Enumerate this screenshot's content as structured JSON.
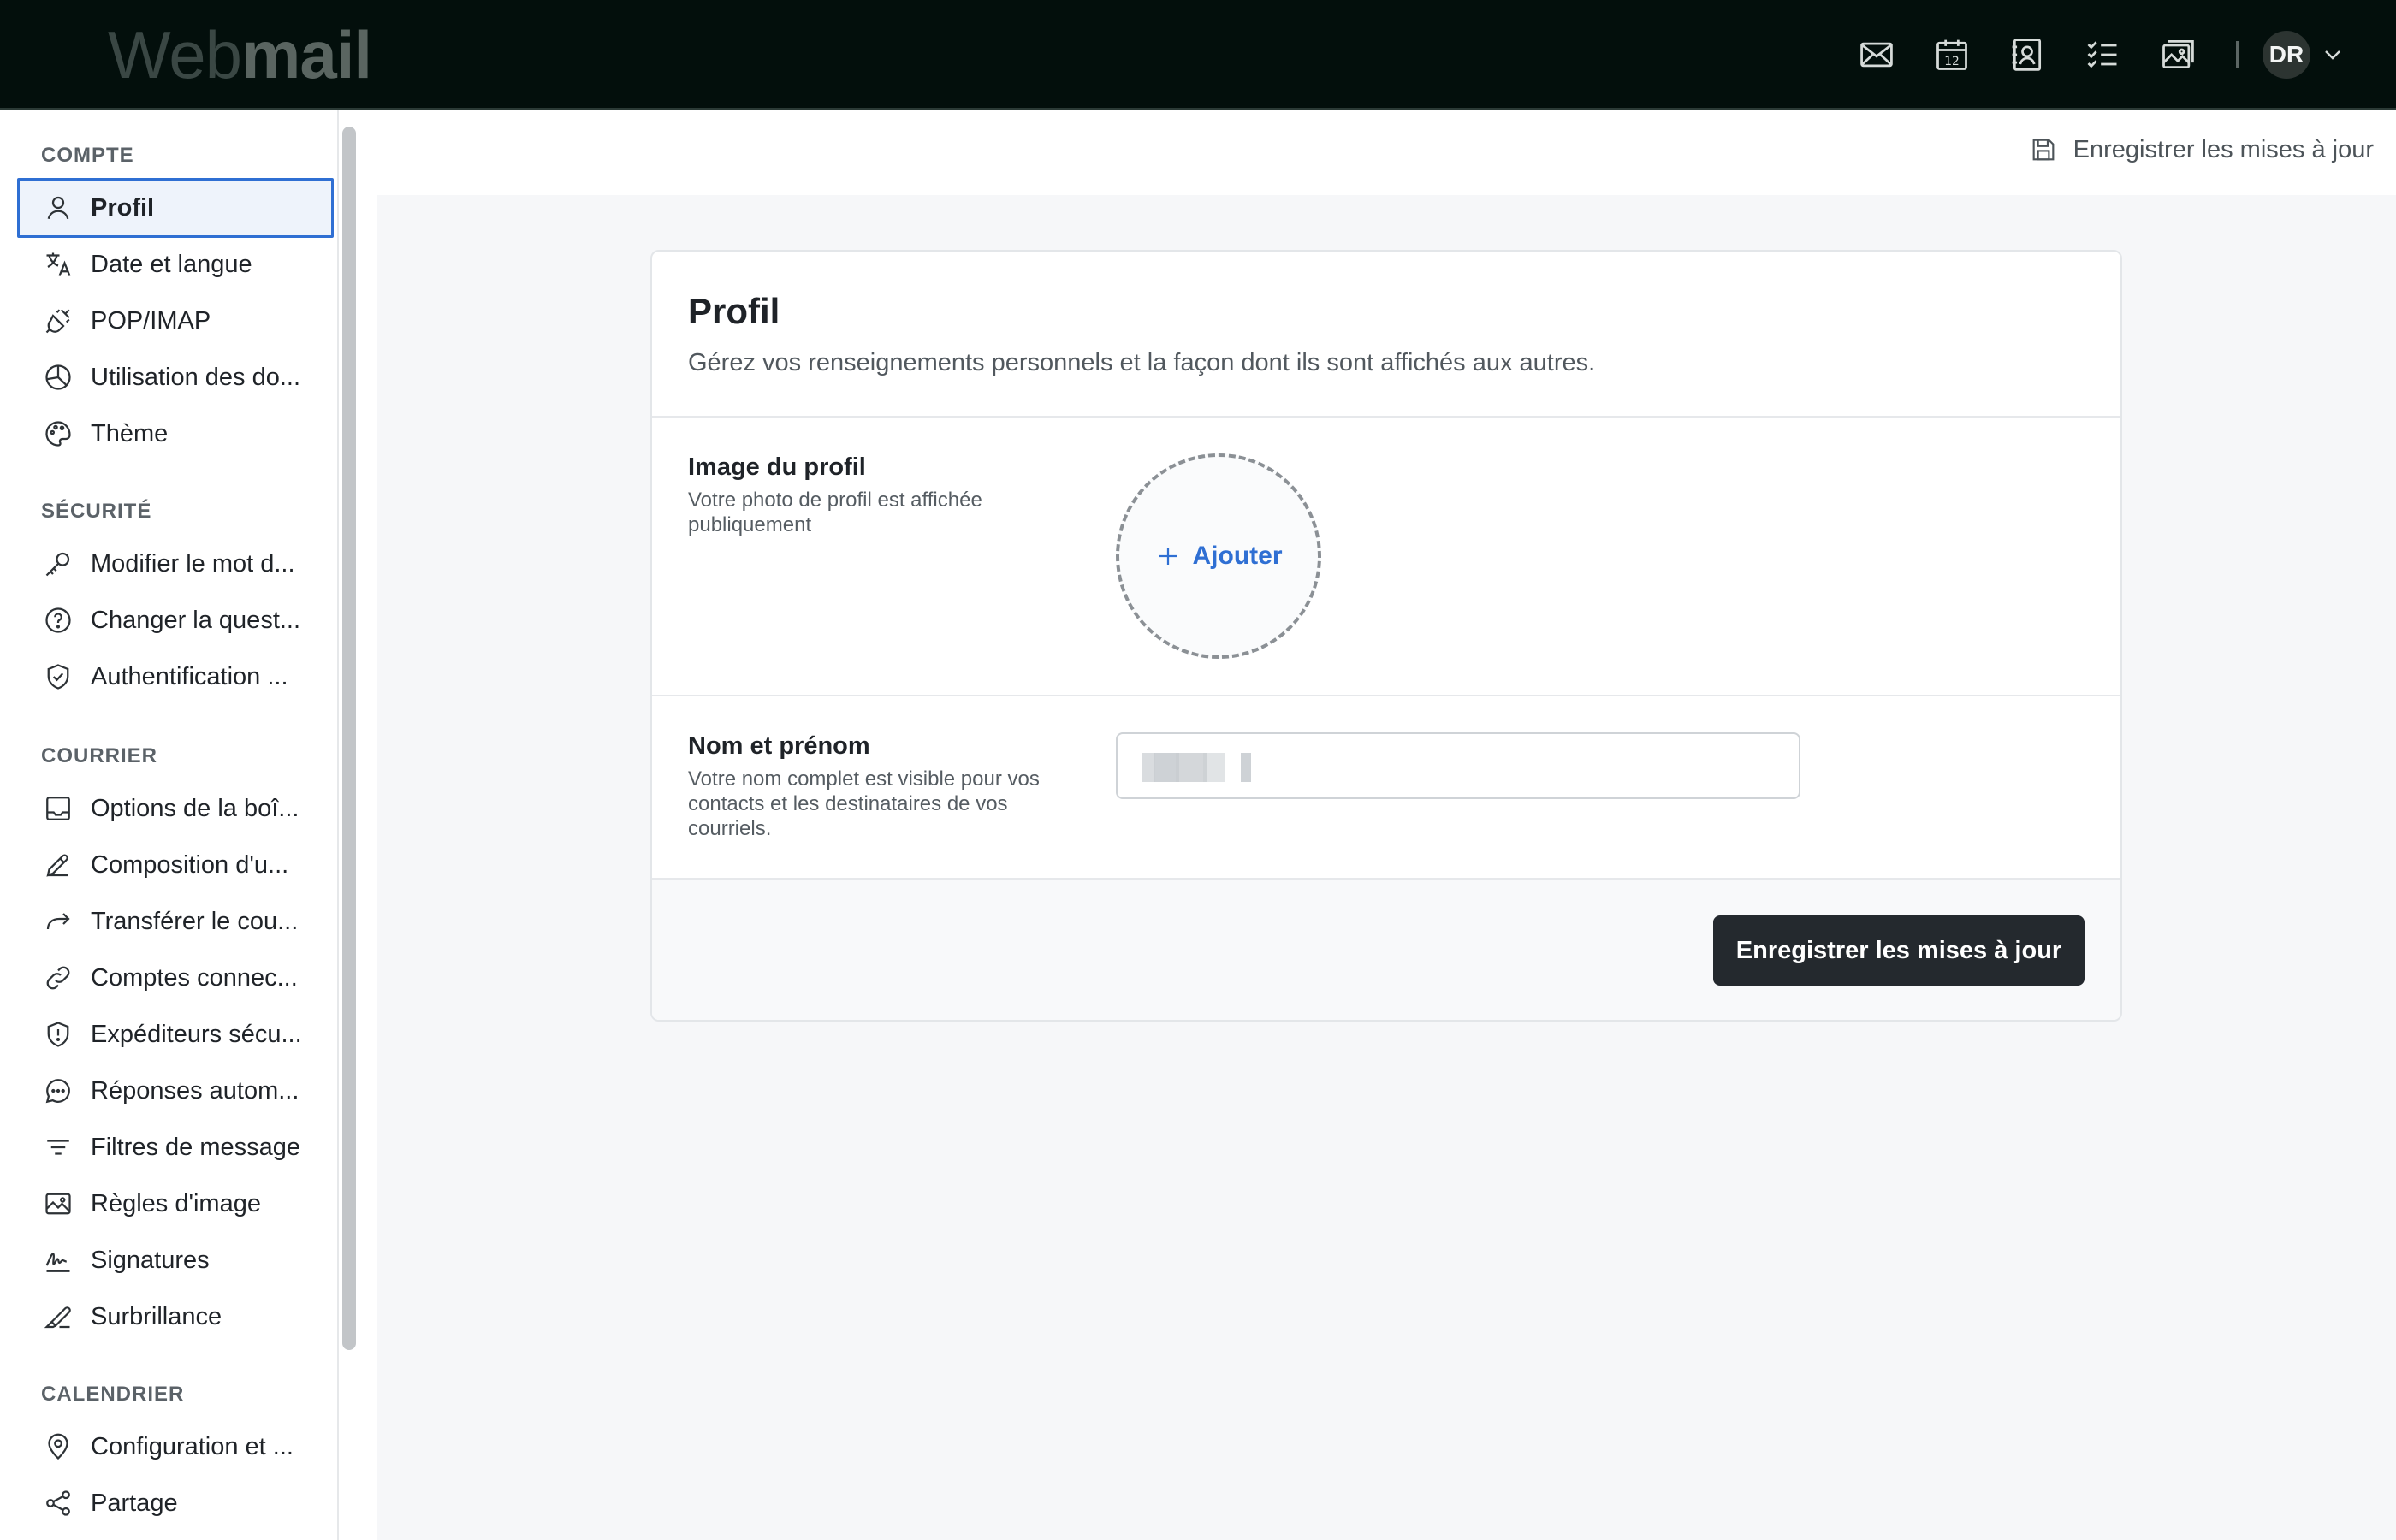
{
  "header": {
    "logo_light": "Web",
    "logo_bold": "mail",
    "icons": [
      "mail-icon",
      "calendar-icon",
      "contacts-icon",
      "tasks-icon",
      "photos-icon"
    ],
    "calendar_day": "12",
    "user_initials": "DR"
  },
  "sidebar": {
    "sections": [
      {
        "title": "COMPTE",
        "items": [
          "Profil",
          "Date et langue",
          "POP/IMAP",
          "Utilisation des do...",
          "Thème"
        ]
      },
      {
        "title": "SÉCURITÉ",
        "items": [
          "Modifier le mot d...",
          "Changer la quest...",
          "Authentification ..."
        ]
      },
      {
        "title": "COURRIER",
        "items": [
          "Options de la boî...",
          "Composition d'u...",
          "Transférer le cou...",
          "Comptes connec...",
          "Expéditeurs sécu...",
          "Réponses autom...",
          "Filtres de message",
          "Règles d'image",
          "Signatures",
          "Surbrillance"
        ]
      },
      {
        "title": "CALENDRIER",
        "items": [
          "Configuration et ...",
          "Partage"
        ]
      }
    ],
    "active_item": "Profil"
  },
  "main": {
    "toolbar_save": "Enregistrer les mises à jour",
    "card": {
      "title": "Profil",
      "subtitle": "Gérez vos renseignements personnels et la façon dont ils sont affichés aux autres.",
      "photo_label": "Image du profil",
      "photo_desc": "Votre photo de profil est affichée publiquement",
      "photo_add": "Ajouter",
      "name_label": "Nom et prénom",
      "name_desc": "Votre nom complet est visible pour vos contacts et les destinataires de vos courriels.",
      "save_button": "Enregistrer les mises à jour"
    }
  },
  "colors": {
    "topbar_bg": "#030f0c",
    "accent": "#2f6fd3",
    "primary_button": "#24292e"
  }
}
